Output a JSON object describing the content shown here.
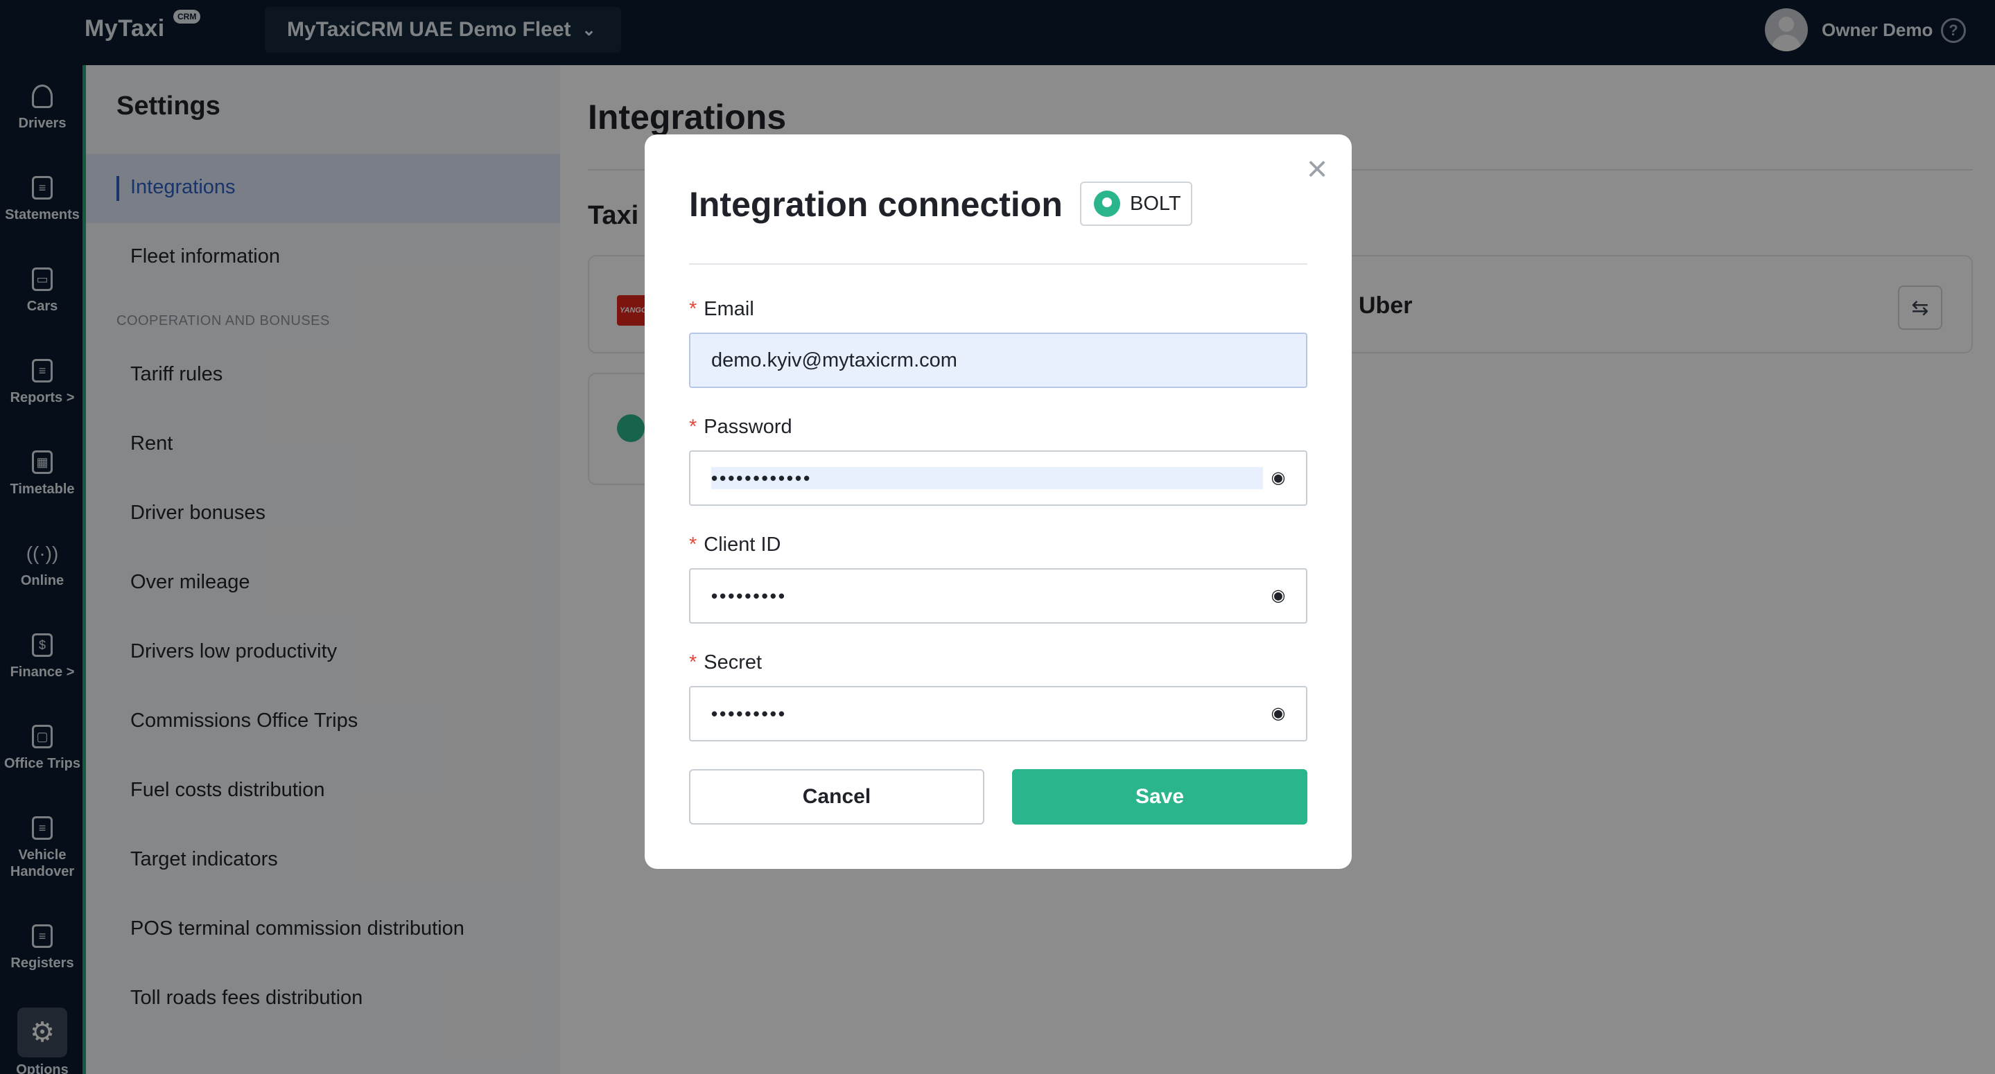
{
  "app": {
    "logo": "MyTaxi",
    "logo_badge": "CRM",
    "fleet_name": "MyTaxiCRM UAE Demo Fleet",
    "user_name": "Owner Demo"
  },
  "rail": {
    "items": [
      {
        "label": "Drivers",
        "icon": "user-icon"
      },
      {
        "label": "Statements",
        "icon": "statement-icon"
      },
      {
        "label": "Cars",
        "icon": "car-icon"
      },
      {
        "label": "Reports >",
        "icon": "report-icon"
      },
      {
        "label": "Timetable",
        "icon": "calendar-icon"
      },
      {
        "label": "Online",
        "icon": "broadcast-icon"
      },
      {
        "label": "Finance >",
        "icon": "finance-icon"
      },
      {
        "label": "Office Trips",
        "icon": "briefcase-icon"
      },
      {
        "label": "Vehicle Handover",
        "icon": "handover-icon"
      },
      {
        "label": "Registers",
        "icon": "register-icon"
      },
      {
        "label": "Options",
        "icon": "gear-icon"
      }
    ]
  },
  "settings": {
    "title": "Settings",
    "items": [
      "Integrations",
      "Fleet information",
      "Tariff rules",
      "Rent",
      "Driver bonuses",
      "Over mileage",
      "Drivers low productivity",
      "Commissions Office Trips",
      "Fuel costs distribution",
      "Target indicators",
      "POS terminal commission distribution",
      "Toll roads fees distribution"
    ],
    "section": "COOPERATION AND BONUSES"
  },
  "main": {
    "title": "Integrations",
    "subtitle": "Taxi",
    "card_uber": "Uber",
    "card_red_logo_text": "YANGO"
  },
  "modal": {
    "title": "Integration connection",
    "provider": "BOLT",
    "email_label": "Email",
    "email_value": "demo.kyiv@mytaxicrm.com",
    "password_label": "Password",
    "password_value": "••••••••••••",
    "client_id_label": "Client ID",
    "client_id_value": "•••••••••",
    "secret_label": "Secret",
    "secret_value": "•••••••••",
    "cancel": "Cancel",
    "save": "Save"
  },
  "colors": {
    "topbar": "#0b1b2e",
    "accent_green": "#2bb58c",
    "active_blue": "#2f5fc4",
    "required": "#e5483c"
  }
}
